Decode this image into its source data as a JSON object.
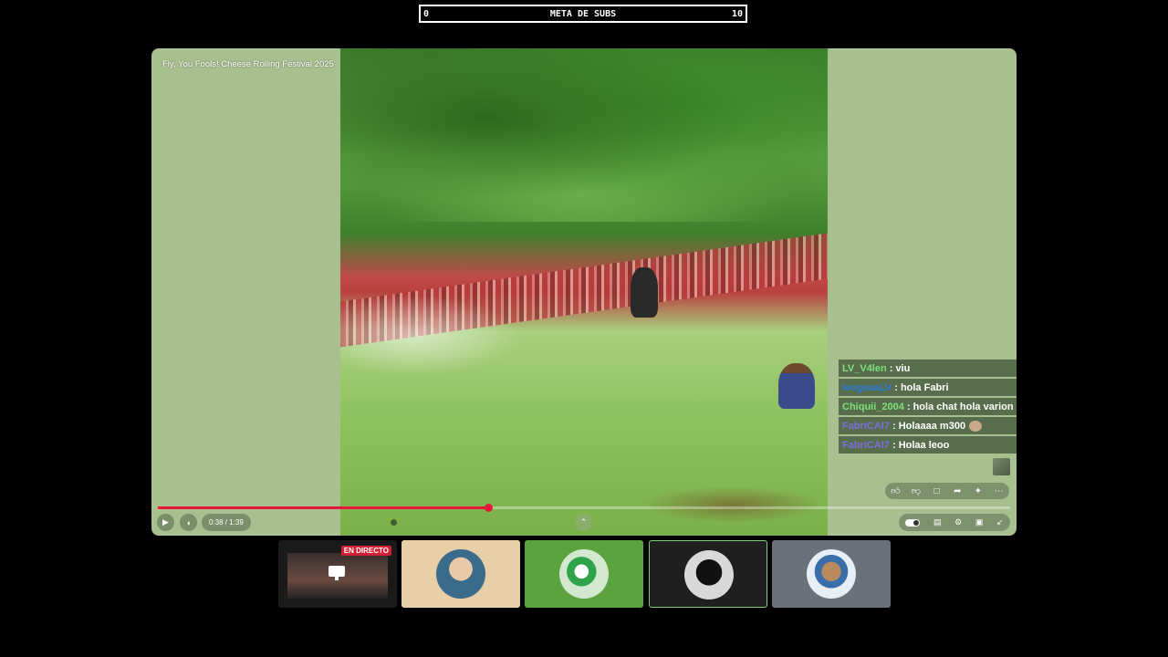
{
  "goal": {
    "left": "0",
    "title": "META DE SUBS",
    "right": "10"
  },
  "video": {
    "title": "Fly, You Fools! Cheese Rolling Festival 2025",
    "time": "0:38 / 1:39",
    "progress_fraction": 0.388
  },
  "chat": [
    {
      "user": "LV_V4len",
      "color": "#7fe07a",
      "text": ": viu",
      "emote": false
    },
    {
      "user": "leogeaaLV",
      "color": "#2b7bd8",
      "text": ": hola Fabri",
      "emote": false
    },
    {
      "user": "Chiquii_2004",
      "color": "#7fe07a",
      "text": ": hola chat hola varion",
      "emote": false
    },
    {
      "user": "FabriCAI7",
      "color": "#7b6fe0",
      "text": ": Holaaaa m300",
      "emote": true
    },
    {
      "user": "FabriCAI7",
      "color": "#7b6fe0",
      "text": ": Holaa leoo",
      "emote": false
    }
  ],
  "tiles": [
    {
      "name": "screen-share",
      "bg": "#1a1a1a",
      "badge": "EN DIRECTO"
    },
    {
      "name": "participant-1",
      "bg": "#e7cfa8"
    },
    {
      "name": "participant-2",
      "bg": "#5aa33e"
    },
    {
      "name": "participant-3",
      "bg": "#1f1f1f"
    },
    {
      "name": "participant-4",
      "bg": "#6b7178"
    }
  ],
  "icons": {
    "play": "play-icon",
    "volume": "volume-icon",
    "like": "thumbs-up-icon",
    "dislike": "thumbs-down-icon",
    "comment": "comment-icon",
    "share": "share-icon",
    "sparkle": "sparkle-icon",
    "more": "more-icon",
    "chevron": "chevron-up-icon",
    "autoplay": "autoplay-toggle-icon",
    "captions": "captions-icon",
    "settings": "gear-icon",
    "cast": "cast-icon",
    "collapse": "collapse-icon"
  },
  "colors": {
    "progress": "#e6183b",
    "panel": "#a8bf8f"
  }
}
